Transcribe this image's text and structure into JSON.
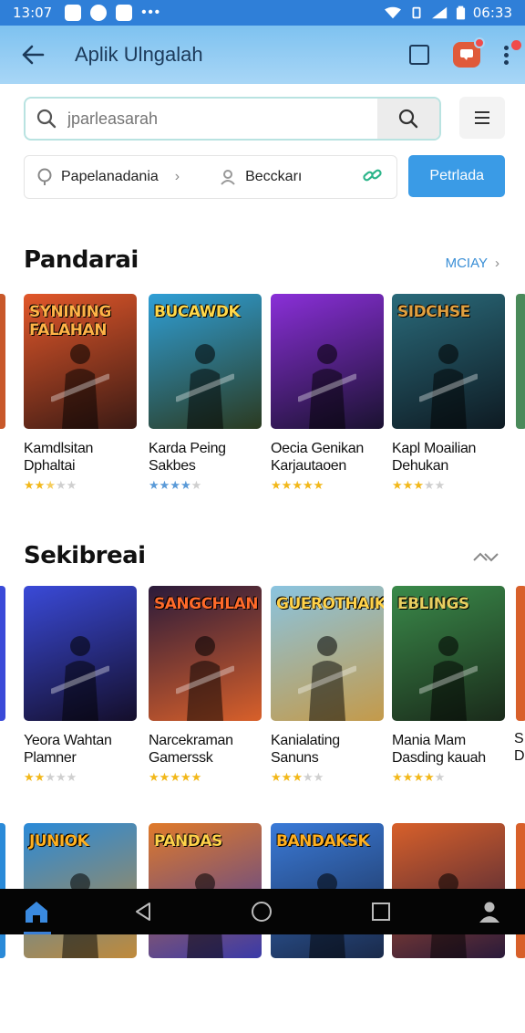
{
  "status": {
    "time": "13:07",
    "right_time": "06:33"
  },
  "app": {
    "title": "Aplik Ulngalah"
  },
  "search": {
    "placeholder": "jparleasarah"
  },
  "filters": {
    "location": "Papelanadania",
    "contact": "Becckarı",
    "button": "Petrlada"
  },
  "sections": [
    {
      "title": "Pandarai",
      "more": "MCIAY",
      "games": [
        {
          "title": "Kamdlsitan Dphaltai",
          "cover": "SYNINING FALAHAN",
          "rating": 2.5,
          "colors": [
            "#e2572a",
            "#3a1a14"
          ],
          "logo_color": "#ffb347"
        },
        {
          "title": "Karda Peing Sakbes",
          "cover": "BUCAWDK",
          "rating": 4,
          "colors": [
            "#2f9fd6",
            "#2b3a20"
          ],
          "logo_color": "#ffd84a"
        },
        {
          "title": "Oecia Genikan Karjautaoen",
          "cover": "",
          "rating": 5,
          "colors": [
            "#8a2fd8",
            "#1a1230"
          ],
          "logo_color": "#ffffff"
        },
        {
          "title": "Kapl Moailian Dehukan",
          "cover": "SIDCHSE",
          "rating": 3,
          "colors": [
            "#2a6a7a",
            "#0e1a22"
          ],
          "logo_color": "#e0a040"
        }
      ]
    },
    {
      "title": "Sekibreai",
      "more": "",
      "games": [
        {
          "title": "Yeora Wahtan Plamner",
          "cover": "",
          "rating": 2,
          "colors": [
            "#3a4ad8",
            "#140e2a"
          ],
          "logo_color": "#ffffff"
        },
        {
          "title": "Narcekraman Gamerssk",
          "cover": "SANGCHLAN",
          "rating": 5,
          "colors": [
            "#2a1a3a",
            "#d8602a"
          ],
          "logo_color": "#ff6a2a"
        },
        {
          "title": "Kanialating Sanuns",
          "cover": "GUEROTHAIK",
          "rating": 3,
          "colors": [
            "#8ac4e0",
            "#c49a4a"
          ],
          "logo_color": "#ffd24a"
        },
        {
          "title": "Mania Mam Dasding kauah",
          "cover": "EBLINGS",
          "rating": 4,
          "colors": [
            "#3a8a4a",
            "#1a2a1a"
          ],
          "logo_color": "#e8d060"
        }
      ]
    },
    {
      "title": "",
      "more": "",
      "games": [
        {
          "title": "",
          "cover": "JUNIOK",
          "rating": 0,
          "colors": [
            "#2a8ad8",
            "#c08a3a"
          ],
          "logo_color": "#ffb020"
        },
        {
          "title": "",
          "cover": "PANDAS",
          "rating": 0,
          "colors": [
            "#e07a2a",
            "#3a3aa8"
          ],
          "logo_color": "#ffd24a"
        },
        {
          "title": "",
          "cover": "BANDAKSK",
          "rating": 0,
          "colors": [
            "#3a7ad8",
            "#1a2a4a"
          ],
          "logo_color": "#ffb020"
        },
        {
          "title": "",
          "cover": "",
          "rating": 0,
          "colors": [
            "#d8602a",
            "#2a1a3a"
          ],
          "logo_color": "#ffffff"
        }
      ]
    }
  ],
  "colors": {
    "accent": "#3a9be6",
    "star": "#f2b81a",
    "star_blue": "#5a9ad8",
    "star_empty": "#cfcfcf"
  }
}
